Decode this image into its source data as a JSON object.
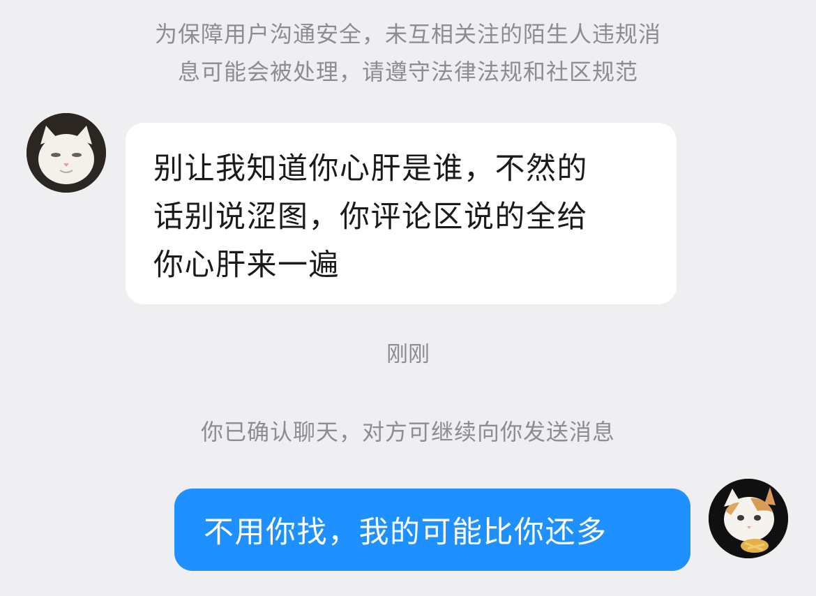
{
  "notice": {
    "line1": "为保障用户沟通安全，未互相关注的陌生人违规消",
    "line2": "息可能会被处理，请遵守法律法规和社区规范"
  },
  "messages": [
    {
      "direction": "incoming",
      "avatar": "white-cat-avatar",
      "lines": [
        "别让我知道你心肝是谁，不然的",
        "话别说涩图，你评论区说的全给",
        "你心肝来一遍"
      ]
    },
    {
      "direction": "outgoing",
      "avatar": "kitten-avatar",
      "text": "不用你找，我的可能比你还多"
    }
  ],
  "timestamp": "刚刚",
  "system_message": "你已确认聊天，对方可继续向你发送消息",
  "colors": {
    "background": "#efeff1",
    "incoming_bubble": "#ffffff",
    "outgoing_bubble": "#1e90ff",
    "meta_text": "#8c8c91"
  }
}
